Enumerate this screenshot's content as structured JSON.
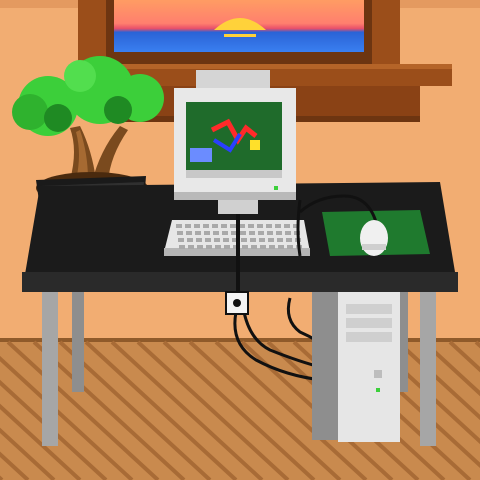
{
  "scene": {
    "title": "",
    "objects": [
      "window",
      "sunset",
      "bonsai-tree",
      "crt-monitor",
      "keyboard",
      "mouse",
      "mouse-pad",
      "desk",
      "power-outlet",
      "pc-tower",
      "wooden-floor"
    ]
  },
  "colors": {
    "wall": "#f2ad72",
    "wall_shade": "#e49a60",
    "floor": "#c98a4e",
    "floor_stripe": "#a86b36",
    "desk_top": "#1b1b1b",
    "desk_leg": "#a6a6a6",
    "window_frame": "#9b4e1a",
    "window_frame_dark": "#6d3511",
    "sky_top": "#ff9c63",
    "sky_bottom": "#2a63d6",
    "sun": "#ffd23a",
    "monitor_body": "#e8e8e8",
    "monitor_shadow": "#b9b9b9",
    "screen": "#1f6b2b",
    "leaf": "#3ccf3a",
    "leaf_dark": "#1f8a23",
    "trunk": "#7a4a1e",
    "pot": "#1a1a1a",
    "mousepad": "#1f7a2e",
    "tower": "#e6e6e6"
  }
}
